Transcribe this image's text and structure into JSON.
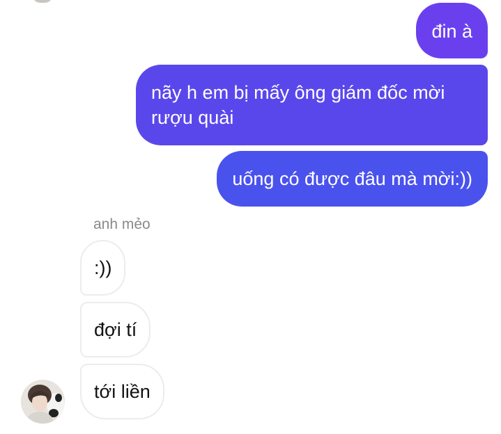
{
  "contact": {
    "name": "anh mẻo"
  },
  "messages": {
    "outgoing": [
      {
        "text": "đin à"
      },
      {
        "text": "nãy h em bị mấy ông giám đốc mời\nrượu quài"
      },
      {
        "text": "uống có được đâu mà mời:))"
      }
    ],
    "incoming": [
      {
        "text": ":))"
      },
      {
        "text": "đợi tí"
      },
      {
        "text": "tới liền"
      }
    ]
  },
  "colors": {
    "outgoing_top": "#6a40ee",
    "outgoing_mid": "#5a47ec",
    "outgoing_bottom": "#4a52ee",
    "incoming_border": "#ececec",
    "sender_name": "#8a8a8a"
  },
  "icons": {
    "avatar": "contact-avatar-photo"
  }
}
